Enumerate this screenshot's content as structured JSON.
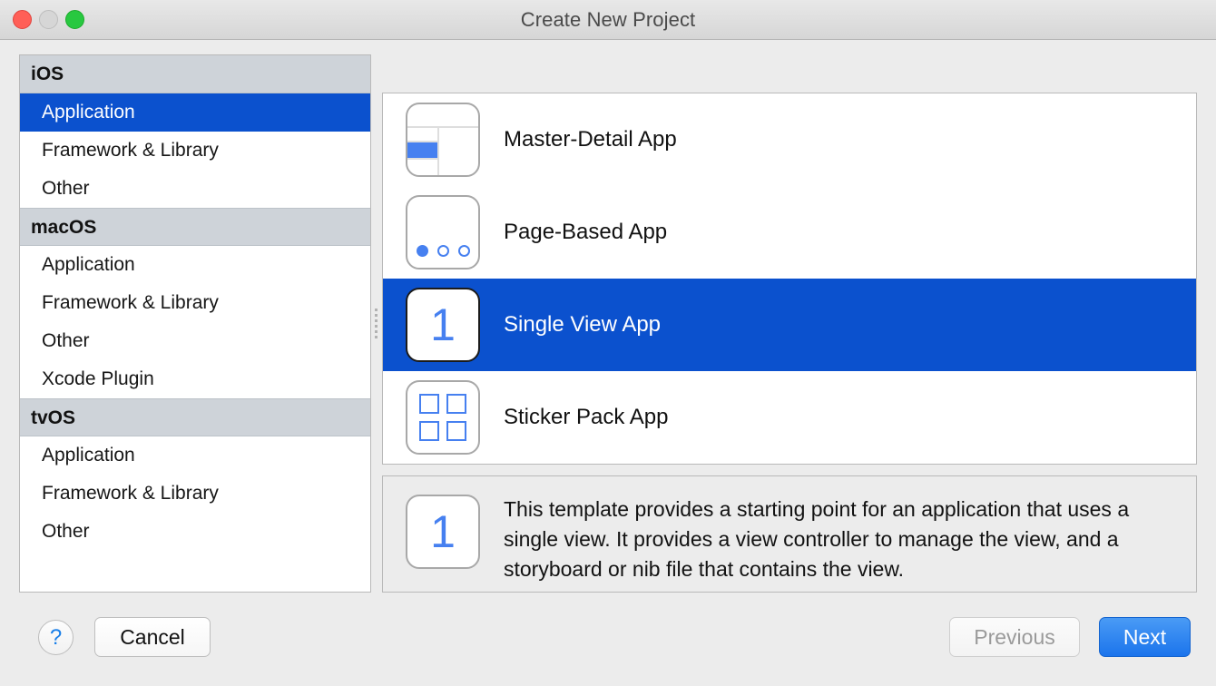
{
  "window": {
    "title": "Create New Project",
    "traffic_lights": [
      {
        "name": "close",
        "color": "#ff5f57"
      },
      {
        "name": "minimize",
        "color": "#d6d6d6"
      },
      {
        "name": "zoom",
        "color": "#28c840"
      }
    ]
  },
  "sidebar": {
    "groups": [
      {
        "header": "iOS",
        "items": [
          {
            "label": "Application",
            "selected": true
          },
          {
            "label": "Framework & Library",
            "selected": false
          },
          {
            "label": "Other",
            "selected": false
          }
        ]
      },
      {
        "header": "macOS",
        "items": [
          {
            "label": "Application",
            "selected": false
          },
          {
            "label": "Framework & Library",
            "selected": false
          },
          {
            "label": "Other",
            "selected": false
          },
          {
            "label": "Xcode Plugin",
            "selected": false
          }
        ]
      },
      {
        "header": "tvOS",
        "items": [
          {
            "label": "Application",
            "selected": false
          },
          {
            "label": "Framework & Library",
            "selected": false
          },
          {
            "label": "Other",
            "selected": false
          }
        ]
      }
    ]
  },
  "templates": [
    {
      "label": "Master-Detail App",
      "icon": "master-detail-icon",
      "selected": false
    },
    {
      "label": "Page-Based App",
      "icon": "page-based-icon",
      "selected": false
    },
    {
      "label": "Single View App",
      "icon": "single-view-icon",
      "glyph": "1",
      "selected": true
    },
    {
      "label": "Sticker Pack App",
      "icon": "sticker-pack-icon",
      "selected": false
    }
  ],
  "description": {
    "icon": "single-view-icon",
    "glyph": "1",
    "text": "This template provides a starting point for an application that uses a single view. It provides a view controller to manage the view, and a storyboard or nib file that contains the view."
  },
  "footer": {
    "help_label": "?",
    "cancel_label": "Cancel",
    "previous_label": "Previous",
    "next_label": "Next"
  },
  "colors": {
    "selection_blue": "#0b51ce",
    "glyph_blue": "#4680f0",
    "default_button_blue": "#1b74ec",
    "group_header_gray": "#ced3d9"
  }
}
